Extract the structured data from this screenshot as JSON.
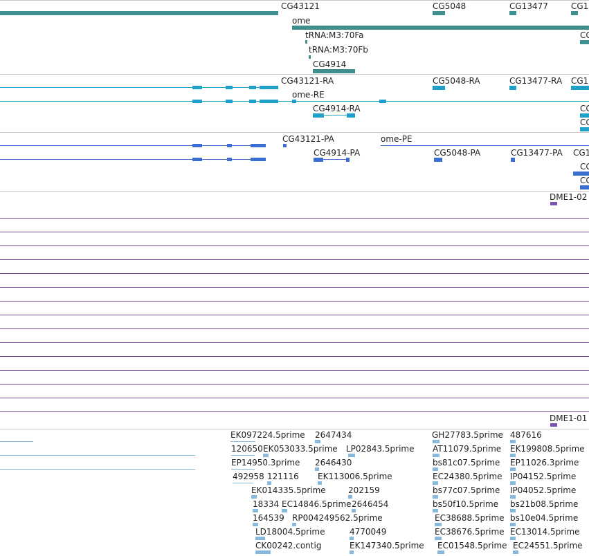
{
  "colors": {
    "gene": "#3f8f8f",
    "transcript": "#1ea0c8",
    "protein": "#3c6ed2",
    "purple": "#7a52b0",
    "est": "#87b9dc",
    "separator": "#c8c8c8",
    "track_line": "#6a4a8c"
  },
  "gene_track": [
    {
      "label": "CG43121",
      "start": 0,
      "end": 402,
      "dir": "left"
    },
    {
      "label": "ome",
      "start": 422,
      "end": 851,
      "dir": "none"
    },
    {
      "label": "tRNA:M3:70Fa",
      "start": 441,
      "end": 443,
      "dir": "left"
    },
    {
      "label": "tRNA:M3:70Fb",
      "start": 446,
      "end": 448,
      "dir": "left"
    },
    {
      "label": "CG4914",
      "start": 452,
      "end": 513,
      "dir": "left"
    },
    {
      "label": "CG5048",
      "start": 625,
      "end": 643,
      "dir": "right"
    },
    {
      "label": "CG13477",
      "start": 736,
      "end": 746,
      "dir": "right"
    },
    {
      "label": "CG1",
      "start": 825,
      "end": 835,
      "dir": "right"
    },
    {
      "label": "CG",
      "start": 838,
      "end": 851,
      "dir": "left"
    }
  ],
  "transcript_track": [
    {
      "label": "CG43121-RA",
      "start": 0,
      "end": 402
    },
    {
      "label": "ome-RE",
      "start": 422,
      "end": 851
    },
    {
      "label": "CG4914-RA",
      "start": 452,
      "end": 513
    },
    {
      "label": "CG5048-RA",
      "start": 625,
      "end": 643
    },
    {
      "label": "CG13477-RA",
      "start": 736,
      "end": 746
    },
    {
      "label": "CG1",
      "start": 825,
      "end": 851
    },
    {
      "label": "CG",
      "start": 838,
      "end": 851
    },
    {
      "label": "CG",
      "start": 838,
      "end": 851
    }
  ],
  "protein_track": [
    {
      "label": "CG43121-PA",
      "start": 0,
      "end": 384
    },
    {
      "label": "ome-PE",
      "start": 550,
      "end": 851
    },
    {
      "label": "CG4914-PA",
      "start": 453,
      "end": 505
    },
    {
      "label": "CG5048-PA",
      "start": 627,
      "end": 639
    },
    {
      "label": "CG13477-PA",
      "start": 738,
      "end": 744
    },
    {
      "label": "CG1",
      "start": 828,
      "end": 851
    },
    {
      "label": "CG",
      "start": 838,
      "end": 851
    },
    {
      "label": "CG",
      "start": 838,
      "end": 851
    }
  ],
  "purple_features": [
    {
      "label": "DME1-02",
      "start": 795,
      "end": 805
    },
    {
      "label": "DME1-01",
      "start": 795,
      "end": 805
    }
  ],
  "est_track": [
    {
      "label": "EK097224.5prime"
    },
    {
      "label": "2647434"
    },
    {
      "label": "GH27783.5prime"
    },
    {
      "label": "487616"
    },
    {
      "label": "120650"
    },
    {
      "label": "EK053033.5prime"
    },
    {
      "label": "LP02843.5prime"
    },
    {
      "label": "AT11079.5prime"
    },
    {
      "label": "EK199808.5prime"
    },
    {
      "label": "EP14950.3prime"
    },
    {
      "label": "2646430"
    },
    {
      "label": "bs81c07.5prime"
    },
    {
      "label": "EP11026.3prime"
    },
    {
      "label": "492958"
    },
    {
      "label": "121116"
    },
    {
      "label": "EK113006.5prime"
    },
    {
      "label": "EC24380.5prime"
    },
    {
      "label": "IP04152.5prime"
    },
    {
      "label": "EK014335.5prime"
    },
    {
      "label": "202159"
    },
    {
      "label": "bs77c07.5prime"
    },
    {
      "label": "IP04052.5prime"
    },
    {
      "label": "18334"
    },
    {
      "label": "EC14846.5prime"
    },
    {
      "label": "2646454"
    },
    {
      "label": "bs50f10.5prime"
    },
    {
      "label": "bs21b08.5prime"
    },
    {
      "label": "164539"
    },
    {
      "label": "RP004249562.5prime"
    },
    {
      "label": "EC38688.5prime"
    },
    {
      "label": "bs10e04.5prime"
    },
    {
      "label": "LD18004.5prime"
    },
    {
      "label": "4770049"
    },
    {
      "label": "EC38676.5prime"
    },
    {
      "label": "EC13014.5prime"
    },
    {
      "label": "CK00242.contig"
    },
    {
      "label": "EK147340.5prime"
    },
    {
      "label": "EC01548.5prime"
    },
    {
      "label": "EC24551.5prime"
    }
  ]
}
